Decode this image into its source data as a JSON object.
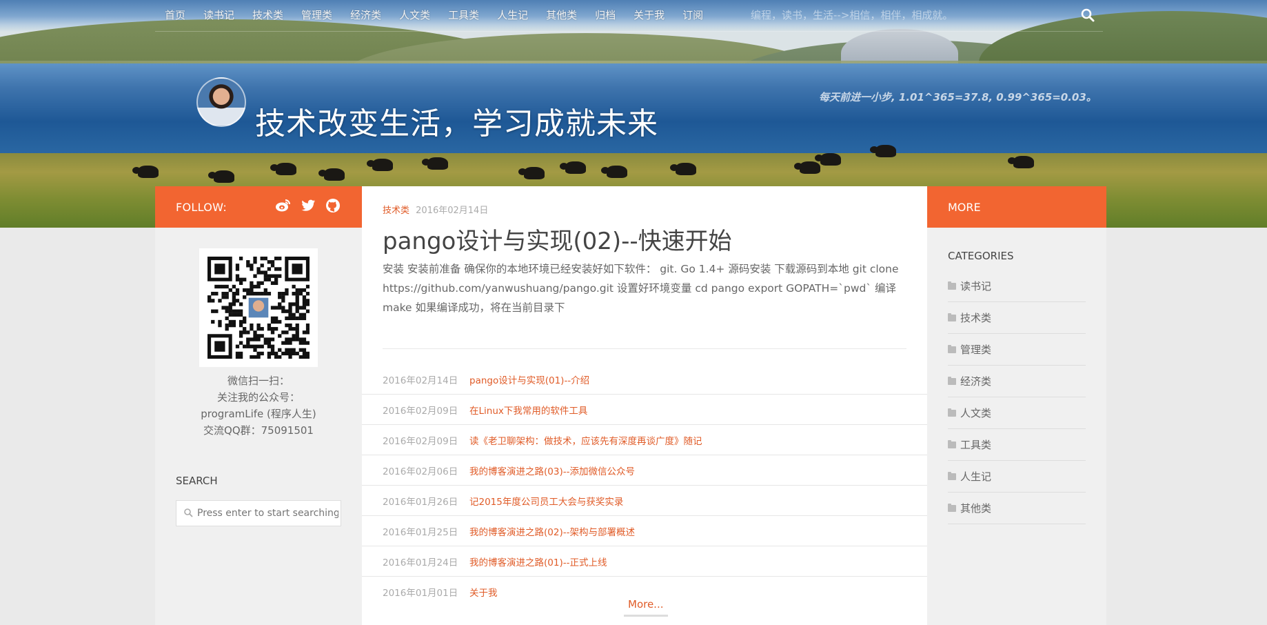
{
  "nav": {
    "items": [
      "首页",
      "读书记",
      "技术类",
      "管理类",
      "经济类",
      "人文类",
      "工具类",
      "人生记",
      "其他类",
      "归档",
      "关于我",
      "订阅"
    ],
    "tagline": "编程，读书，生活-->相信，相伴，相成就。",
    "search_icon": "search-icon"
  },
  "site": {
    "title": "技术改变生活，学习成就未来",
    "description": "每天前进一小步, 1.01^365=37.8, 0.99^365=0.03。"
  },
  "left_sidebar": {
    "follow_label": "FOLLOW:",
    "social_icons": [
      "weibo-icon",
      "twitter-icon",
      "github-icon"
    ],
    "qr_caption": [
      "微信扫一扫：",
      "关注我的公众号：",
      "programLife (程序人生)",
      "交流QQ群：75091501"
    ],
    "search_heading": "SEARCH",
    "search_placeholder": "Press enter to start searching"
  },
  "post": {
    "category": "技术类",
    "date": "2016年02月14日",
    "title": "pango设计与实现(02)--快速开始",
    "excerpt": "安装 安装前准备 确保你的本地环境已经安装好如下软件： git. Go 1.4+ 源码安装 下载源码到本地 git clone https://github.com/yanwushuang/pango.git 设置好环境变量 cd pango export GOPATH=`pwd` 编译 make 如果编译成功，将在当前目录下"
  },
  "recent_posts": [
    {
      "date": "2016年02月14日",
      "title": "pango设计与实现(01)--介绍"
    },
    {
      "date": "2016年02月09日",
      "title": "在Linux下我常用的软件工具"
    },
    {
      "date": "2016年02月09日",
      "title": "读《老卫聊架构：做技术，应该先有深度再谈广度》随记"
    },
    {
      "date": "2016年02月06日",
      "title": "我的博客演进之路(03)--添加微信公众号"
    },
    {
      "date": "2016年01月26日",
      "title": "记2015年度公司员工大会与获奖实录"
    },
    {
      "date": "2016年01月25日",
      "title": "我的博客演进之路(02)--架构与部署概述"
    },
    {
      "date": "2016年01月24日",
      "title": "我的博客演进之路(01)--正式上线"
    },
    {
      "date": "2016年01月01日",
      "title": "关于我"
    }
  ],
  "more_link": "More...",
  "right_sidebar": {
    "heading": "MORE",
    "categories_heading": "CATEGORIES",
    "categories": [
      "读书记",
      "技术类",
      "管理类",
      "经济类",
      "人文类",
      "工具类",
      "人生记",
      "其他类"
    ]
  },
  "colors": {
    "accent": "#f26531",
    "link": "#e05b27"
  }
}
